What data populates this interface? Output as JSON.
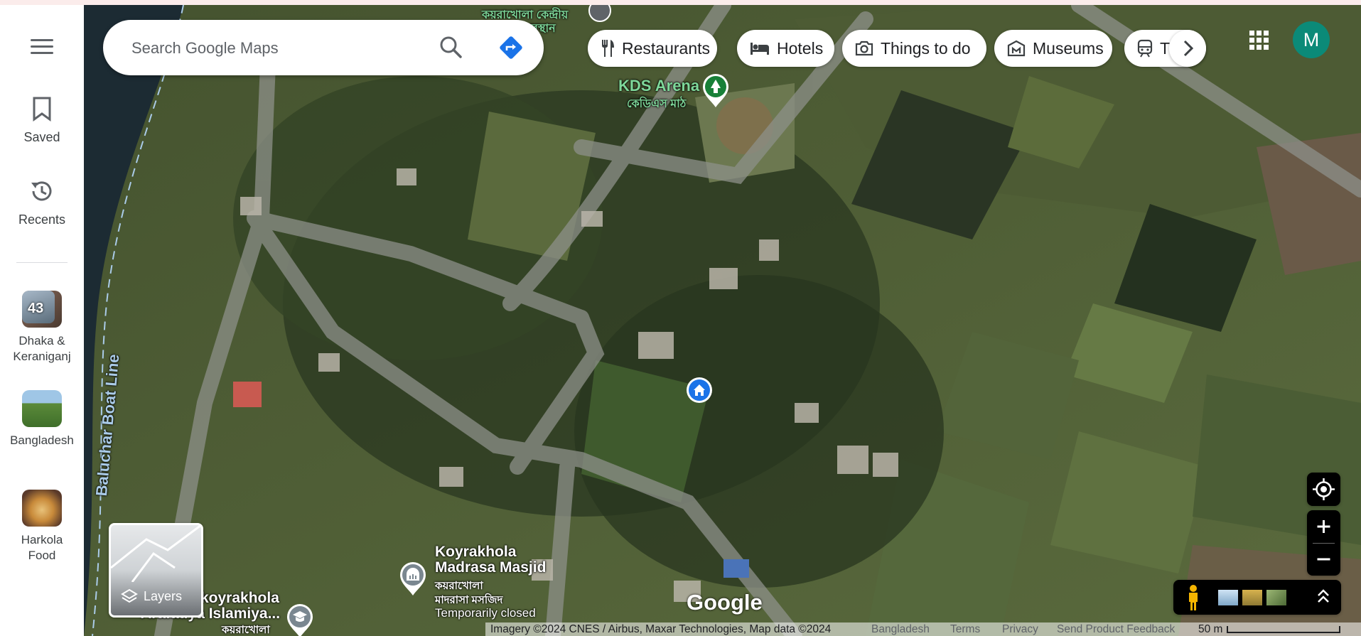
{
  "search": {
    "placeholder": "Search Google Maps"
  },
  "rail": {
    "saved_label": "Saved",
    "recents_label": "Recents",
    "recent_places": [
      {
        "label": "Dhaka & Keraniganj",
        "badge": "43"
      },
      {
        "label": "Bangladesh",
        "badge": ""
      },
      {
        "label": "Harkola Food",
        "badge": ""
      }
    ]
  },
  "chips": [
    {
      "label": "Restaurants",
      "icon": "fork-knife-icon"
    },
    {
      "label": "Hotels",
      "icon": "bed-icon"
    },
    {
      "label": "Things to do",
      "icon": "camera-icon"
    },
    {
      "label": "Museums",
      "icon": "museum-icon"
    },
    {
      "label": "T",
      "icon": "train-icon"
    }
  ],
  "account": {
    "initial": "M",
    "color": "#0b8a78"
  },
  "map_labels": {
    "top_bengali_1": "কয়রাখোলা কেন্দ্রীয়",
    "top_bengali_2": "কবরস্থান",
    "kds_arena": "KDS Arena",
    "kds_arena_bn": "কেডিএস মাঠ",
    "water_line": "Baluchar Boat Line",
    "masjid_title_1": "Koyrakhola",
    "masjid_title_2": "Madrasa Masjid",
    "masjid_bn_1": "কয়রাখোলা",
    "masjid_bn_2": "মাদরাসা মসজিদ",
    "masjid_status": "Temporarily closed",
    "madrasa_1": "koyrakhola",
    "madrasa_2": "Arafatiya Islamiya...",
    "madrasa_bn": "কয়রাখোলা",
    "watermark": "Google"
  },
  "layers": {
    "label": "Layers"
  },
  "footer": {
    "imagery": "Imagery ©2024 CNES / Airbus, Maxar Technologies, Map data ©2024",
    "country": "Bangladesh",
    "terms": "Terms",
    "privacy": "Privacy",
    "feedback": "Send Product Feedback",
    "scale": "50 m"
  },
  "colors": {
    "accent_blue": "#1a73e8",
    "home_pin": "#1a73e8",
    "park_pin": "#188038"
  }
}
